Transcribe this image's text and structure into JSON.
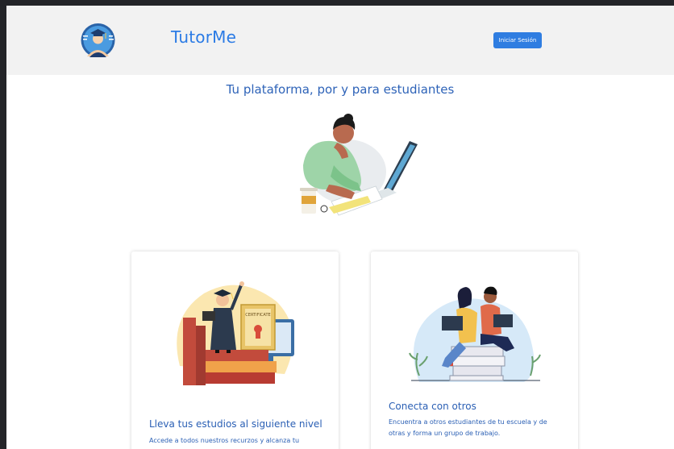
{
  "navbar": {
    "brand": "TutorMe",
    "login_label": "Iniciar Sesión"
  },
  "hero": {
    "title": "Tu plataforma, por y para estudiantes"
  },
  "cards": [
    {
      "title": "Lleva tus estudios al siguiente nivel",
      "text": "Accede a todos nuestros recurzos y alcanza tu potencial"
    },
    {
      "title": "Conecta con otros",
      "text": "Encuentra a otros estudiantes de tu escuela y de otras y forma un grupo de trabajo."
    }
  ],
  "colors": {
    "brand": "#2b7be5",
    "primary_button": "#2f7de1",
    "heading": "#2e63b8",
    "navbar_bg": "#f2f2f2"
  },
  "icons": {
    "logo": "graduate-avatar-logo",
    "hero": "student-laptop-illustration",
    "card_1": "graduation-certificate-illustration",
    "card_2": "students-laptops-books-illustration"
  }
}
